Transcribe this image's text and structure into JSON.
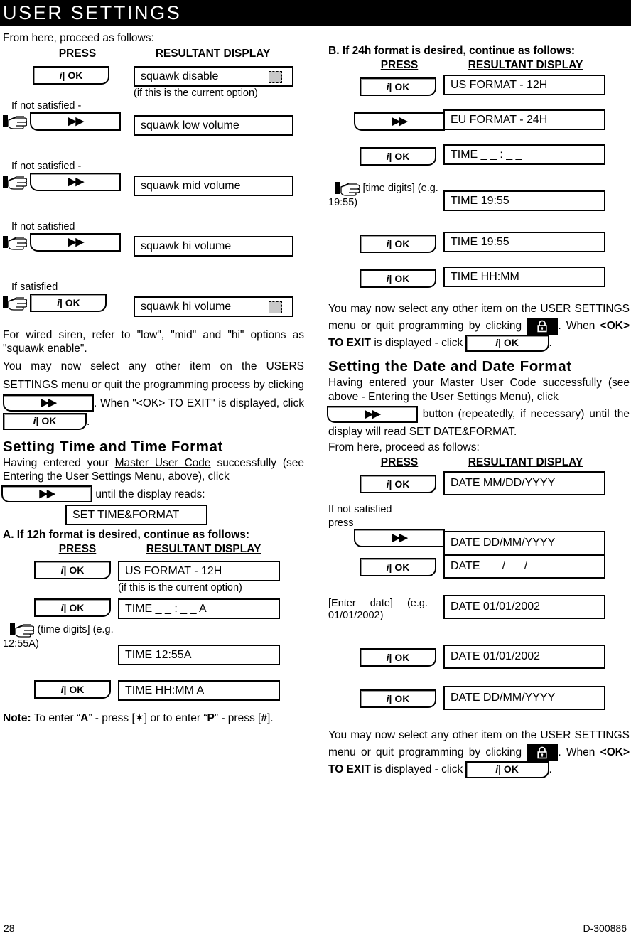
{
  "page": {
    "banner_title": "USER SETTINGS",
    "footer_page_number": "28",
    "footer_doc_number": "D-300886"
  },
  "keys": {
    "ok_i": "i",
    "ok_sep": "|",
    "ok_label": "OK",
    "ff_label": "▶▶"
  },
  "table_headers": {
    "press": "PRESS",
    "resultant_display": "RESULTANT DISPLAY"
  },
  "left": {
    "intro": "From here, proceed as follows:",
    "squawk_steps": [
      {
        "prompt": "",
        "display": "squawk disable",
        "display_note": "(if this is the current option)",
        "shaded": true,
        "key": "ok"
      },
      {
        "prompt": "If not satisfied -",
        "display": "squawk low volume",
        "display_note": "",
        "shaded": false,
        "key": "ff"
      },
      {
        "prompt": "If not satisfied -",
        "display": "squawk mid volume",
        "display_note": "",
        "shaded": false,
        "key": "ff"
      },
      {
        "prompt": "If not satisfied",
        "display": "squawk hi volume",
        "display_note": "",
        "shaded": false,
        "key": "ff"
      },
      {
        "prompt": "If satisfied",
        "display": "squawk hi volume",
        "display_note": "",
        "shaded": true,
        "key": "ok"
      }
    ],
    "para_wired_siren": "For wired siren, refer to \"low\", \"mid\" and \"hi\" options as \"squawk enable\".",
    "para_exit_a": "You may now select any other item on the USERS SETTINGS menu or quit the programming process by clicking",
    "para_exit_b": ". When \"<OK> TO EXIT\" is",
    "para_exit_c": "displayed, click",
    "para_exit_d": ".",
    "time_section": {
      "title": "Setting Time and Time Format",
      "para_a": "Having entered your",
      "master_user_code": "Master User Code",
      "para_b": "successfully (see Entering the User Settings Menu, above), click",
      "para_c": "until the display reads:",
      "display_set_time": "SET TIME&FORMAT",
      "sub_head_a": "A. If 12h format is desired, continue as follows:",
      "steps": [
        {
          "prompt_kind": "ok",
          "prompt_text": "",
          "display": "US FORMAT  -  12H",
          "display_note": "(if this is the current option)"
        },
        {
          "prompt_kind": "ok",
          "prompt_text": "",
          "display": "TIME    _ _ : _ _  A",
          "display_note": ""
        },
        {
          "prompt_kind": "hand-text",
          "prompt_text": "(time digits] (e.g. 12:55A)",
          "display": "TIME     12:55A",
          "display_note": ""
        },
        {
          "prompt_kind": "ok",
          "prompt_text": "",
          "display": "TIME      HH:MM  A",
          "display_note": ""
        }
      ],
      "note_label": "Note:",
      "note_text_1": "To enter “",
      "note_a": "A",
      "note_text_2": "” - press [",
      "note_star": "✶",
      "note_text_3": "] or to enter “",
      "note_p": "P",
      "note_text_4": "” - press [",
      "note_hash": "#",
      "note_text_5": "]."
    }
  },
  "right": {
    "sub_head_b": "B. If 24h format is desired, continue as follows:",
    "time24_steps": [
      {
        "prompt_kind": "ok",
        "prompt_text": "",
        "display": "US FORMAT  -  12H"
      },
      {
        "prompt_kind": "ff",
        "prompt_text": "",
        "display": "EU FORMAT  -  24H"
      },
      {
        "prompt_kind": "ok",
        "prompt_text": "",
        "display": "TIME            _ _ : _ _"
      },
      {
        "prompt_kind": "hand-text",
        "prompt_text": "[time digits] (e.g. 19:55)",
        "display": "TIME    19:55"
      },
      {
        "prompt_kind": "ok",
        "prompt_text": "",
        "display": "TIME      19:55"
      },
      {
        "prompt_kind": "ok",
        "prompt_text": "",
        "display": "TIME      HH:MM"
      }
    ],
    "para_exit_1a": "You may now select any other item on the USER SETTINGS menu or quit programming by clicking",
    "para_exit_1b": ". When",
    "para_exit_1c": "<OK>",
    "para_exit_1d": "TO EXIT",
    "para_exit_1e": "is displayed -  click",
    "para_exit_1f": ".",
    "date_section": {
      "title": "Setting the Date and Date Format",
      "para_a": "Having entered your",
      "master_user_code": "Master User Code",
      "para_b": "successfully (see above - Entering the User Settings Menu),  click",
      "para_c": "button (repeatedly, if necessary) until the display will read SET DATE&FORMAT.",
      "para_d": "From here, proceed as follows:",
      "steps": [
        {
          "prompt_kind": "ok",
          "prompt_text": "",
          "display": "DATE MM/DD/YYYY"
        },
        {
          "prompt_kind": "ff-text",
          "prompt_text_line1": "If not satisfied",
          "prompt_text_line2": "press",
          "display": "DATE DD/MM/YYYY"
        },
        {
          "prompt_kind": "ok",
          "prompt_text": "",
          "display": "DATE  _ _ / _ _/_ _ _ _"
        },
        {
          "prompt_kind": "text",
          "prompt_text": "[Enter date] (e.g. 01/01/2002)",
          "display": "DATE 01/01/2002"
        },
        {
          "prompt_kind": "ok",
          "prompt_text": "",
          "display": "DATE 01/01/2002"
        },
        {
          "prompt_kind": "ok",
          "prompt_text": "",
          "display": "DATE DD/MM/YYYY"
        }
      ]
    },
    "para_exit_2a": "You may now select any other item on the USER SETTINGS menu or quit programming by clicking",
    "para_exit_2b": ". When",
    "para_exit_2c": "<OK>",
    "para_exit_2d": "TO EXIT",
    "para_exit_2e": "is displayed -  click",
    "para_exit_2f": "."
  }
}
